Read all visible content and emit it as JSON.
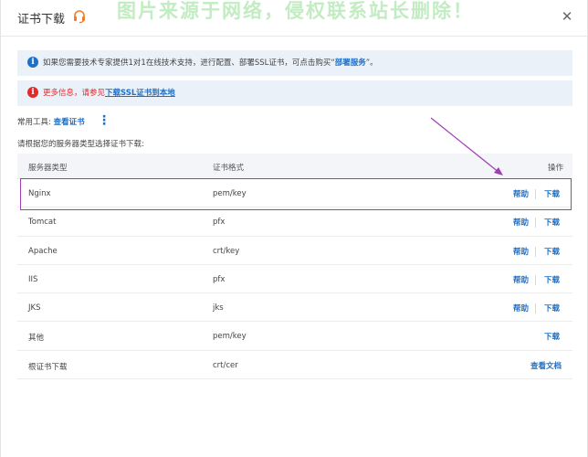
{
  "dialog": {
    "title": "证书下载",
    "watermark": "图片来源于网络，侵权联系站长删除！"
  },
  "notice1": {
    "text": "如果您需要技术专家提供1对1在线技术支持，进行配置、部署SSL证书，可点击购买“",
    "link": "部署服务",
    "suffix": "”。"
  },
  "notice2": {
    "red": "更多信息，请参见",
    "link": "下载SSL证书到本地"
  },
  "tools": {
    "label": "常用工具:",
    "link": "查看证书"
  },
  "hint": "请根据您的服务器类型选择证书下载:",
  "table": {
    "headers": {
      "server": "服务器类型",
      "format": "证书格式",
      "action": "操作"
    },
    "rows": [
      {
        "server": "Nginx",
        "format": "pem/key",
        "help": "帮助",
        "download": "下载"
      },
      {
        "server": "Tomcat",
        "format": "pfx",
        "help": "帮助",
        "download": "下载"
      },
      {
        "server": "Apache",
        "format": "crt/key",
        "help": "帮助",
        "download": "下载"
      },
      {
        "server": "IIS",
        "format": "pfx",
        "help": "帮助",
        "download": "下载"
      },
      {
        "server": "JKS",
        "format": "jks",
        "help": "帮助",
        "download": "下载"
      },
      {
        "server": "其他",
        "format": "pem/key",
        "download": "下载"
      },
      {
        "server": "根证书下载",
        "format": "crt/cer",
        "doc": "查看文档"
      }
    ]
  },
  "colors": {
    "link": "#1f6fc5",
    "annotation": "#a03db5",
    "notice_bg": "#eaf1f9"
  }
}
